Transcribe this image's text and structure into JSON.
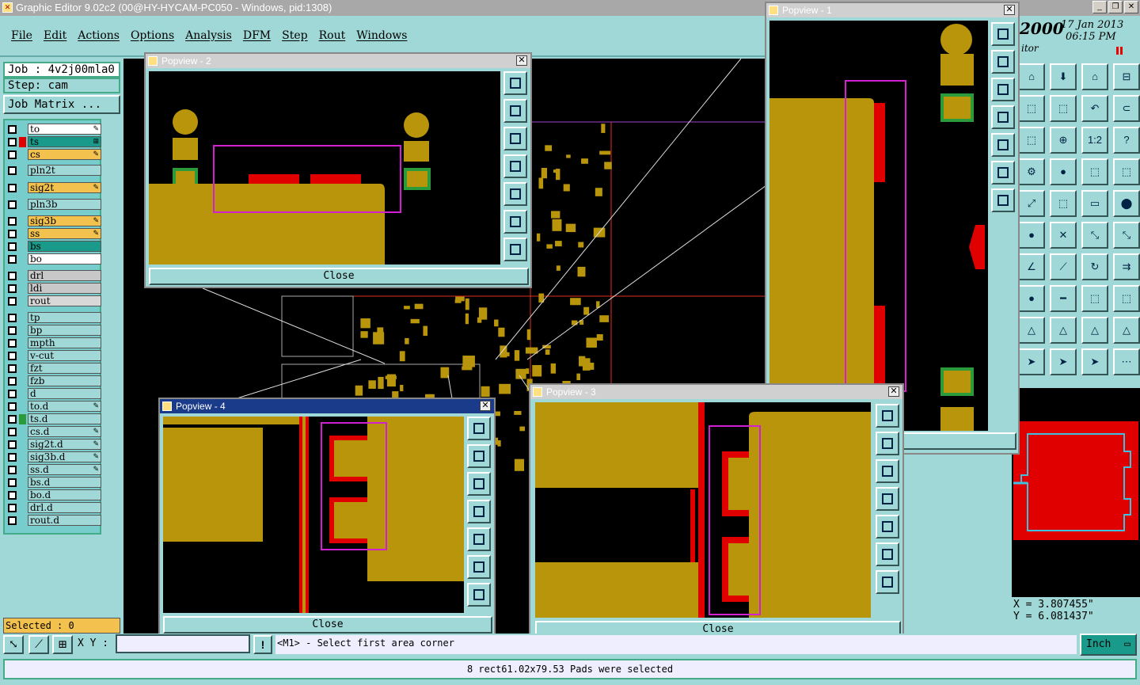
{
  "window_title": "Graphic Editor 9.02c2 (00@HY-HYCAM-PC050 - Windows, pid:1308)",
  "menu": [
    "File",
    "Edit",
    "Actions",
    "Options",
    "Analysis",
    "DFM",
    "Step",
    "Rout",
    "Windows"
  ],
  "job": "Job : 4v2j00mla0",
  "step": "Step: cam",
  "job_matrix": "Job Matrix ...",
  "layers": [
    {
      "name": "to",
      "bg": "#ffffff",
      "swatch": "",
      "mark": "✎"
    },
    {
      "name": "ts",
      "bg": "#1a9a8a",
      "swatch": "#e00000",
      "mark": "⊞"
    },
    {
      "name": "cs",
      "bg": "#f2c14e",
      "swatch": "",
      "mark": "✎"
    },
    {
      "name": "pln2t",
      "bg": "#9fd8d6",
      "swatch": "",
      "mark": ""
    },
    {
      "name": "sig2t",
      "bg": "#f2c14e",
      "swatch": "",
      "mark": "✎"
    },
    {
      "name": "pln3b",
      "bg": "#9fd8d6",
      "swatch": "",
      "mark": ""
    },
    {
      "name": "sig3b",
      "bg": "#f2c14e",
      "swatch": "",
      "mark": "✎"
    },
    {
      "name": "ss",
      "bg": "#f2c14e",
      "swatch": "",
      "mark": "✎"
    },
    {
      "name": "bs",
      "bg": "#1a9a8a",
      "swatch": "",
      "mark": ""
    },
    {
      "name": "bo",
      "bg": "#ffffff",
      "swatch": "",
      "mark": ""
    },
    {
      "name": "drl",
      "bg": "#c8c8c8",
      "swatch": "",
      "mark": ""
    },
    {
      "name": "ldi",
      "bg": "#c8c8c8",
      "swatch": "",
      "mark": ""
    },
    {
      "name": "rout",
      "bg": "#d8d8d8",
      "swatch": "",
      "mark": ""
    },
    {
      "name": "tp",
      "bg": "#9fd8d6",
      "swatch": "",
      "mark": ""
    },
    {
      "name": "bp",
      "bg": "#9fd8d6",
      "swatch": "",
      "mark": ""
    },
    {
      "name": "mpth",
      "bg": "#9fd8d6",
      "swatch": "",
      "mark": ""
    },
    {
      "name": "v-cut",
      "bg": "#9fd8d6",
      "swatch": "",
      "mark": ""
    },
    {
      "name": "fzt",
      "bg": "#9fd8d6",
      "swatch": "",
      "mark": ""
    },
    {
      "name": "fzb",
      "bg": "#9fd8d6",
      "swatch": "",
      "mark": ""
    },
    {
      "name": "d",
      "bg": "#9fd8d6",
      "swatch": "",
      "mark": ""
    },
    {
      "name": "to.d",
      "bg": "#9fd8d6",
      "swatch": "",
      "mark": "✎"
    },
    {
      "name": "ts.d",
      "bg": "#9fd8d6",
      "swatch": "#2a9a3a",
      "mark": ""
    },
    {
      "name": "cs.d",
      "bg": "#9fd8d6",
      "swatch": "",
      "mark": "✎"
    },
    {
      "name": "sig2t.d",
      "bg": "#9fd8d6",
      "swatch": "",
      "mark": "✎"
    },
    {
      "name": "sig3b.d",
      "bg": "#9fd8d6",
      "swatch": "",
      "mark": "✎"
    },
    {
      "name": "ss.d",
      "bg": "#9fd8d6",
      "swatch": "",
      "mark": "✎"
    },
    {
      "name": "bs.d",
      "bg": "#9fd8d6",
      "swatch": "",
      "mark": ""
    },
    {
      "name": "bo.d",
      "bg": "#9fd8d6",
      "swatch": "",
      "mark": ""
    },
    {
      "name": "drl.d",
      "bg": "#9fd8d6",
      "swatch": "",
      "mark": ""
    },
    {
      "name": "rout.d",
      "bg": "#9fd8d6",
      "swatch": "",
      "mark": ""
    }
  ],
  "selected": "Selected : 0",
  "popviews": {
    "p1": "Popview - 1",
    "p2": "Popview - 2",
    "p3": "Popview - 3",
    "p4": "Popview - 4"
  },
  "close_label": "Close",
  "header_right": {
    "version": "2000",
    "date": "17 Jan 2013",
    "time": "06:15 PM",
    "subtitle": "itor"
  },
  "coords": {
    "x": "X = 3.807455\"",
    "y": "Y = 6.081437\""
  },
  "xy_label": "X Y :",
  "xy_value": "",
  "prompt": "<M1> - Select first area corner",
  "units": "Inch",
  "status": "8 rect61.02x79.53 Pads were selected",
  "hidden_close_fragment": "e",
  "colors": {
    "copper": "#b8950a",
    "red": "#e00000",
    "magenta": "#d020d0",
    "green": "#2a9a3a",
    "panel": "#9fd8d6"
  },
  "icons": [
    "home-icon",
    "zoom-fit-icon",
    "question-icon",
    "ratio-1-2-icon",
    "select-arrow-icon"
  ]
}
